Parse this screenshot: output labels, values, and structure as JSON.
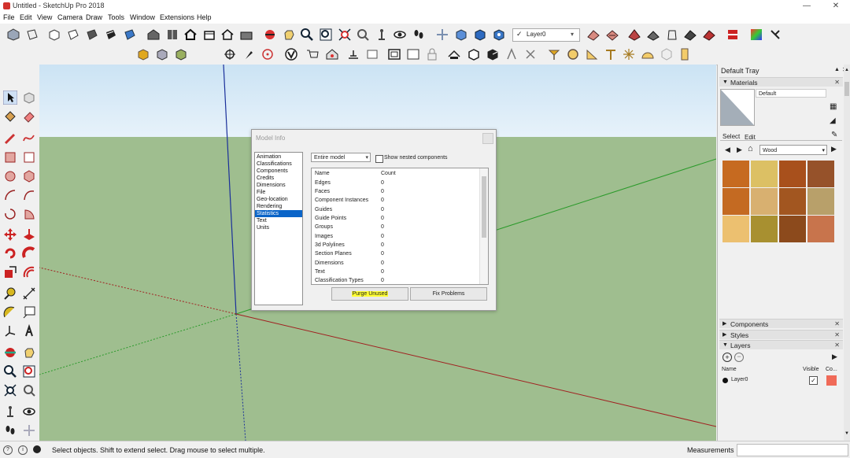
{
  "window": {
    "title": "Untitled - SketchUp Pro 2018",
    "minimize": "—",
    "maximize": "□",
    "close": "✕"
  },
  "menu": [
    "File",
    "Edit",
    "View",
    "Camera",
    "Draw",
    "Tools",
    "Window",
    "Extensions",
    "Help"
  ],
  "toolbar": {
    "layer_value": "Layer0"
  },
  "model_info": {
    "title": "Model Info",
    "categories": [
      "Animation",
      "Classifications",
      "Components",
      "Credits",
      "Dimensions",
      "File",
      "Geo-location",
      "Rendering",
      "Statistics",
      "Text",
      "Units"
    ],
    "selected_category": "Statistics",
    "scope_value": "Entire model",
    "show_nested_label": "Show nested components",
    "columns": {
      "name": "Name",
      "count": "Count"
    },
    "rows": [
      {
        "name": "Edges",
        "count": "0"
      },
      {
        "name": "Faces",
        "count": "0"
      },
      {
        "name": "Component Instances",
        "count": "0"
      },
      {
        "name": "Guides",
        "count": "0"
      },
      {
        "name": "Guide Points",
        "count": "0"
      },
      {
        "name": "Groups",
        "count": "0"
      },
      {
        "name": "Images",
        "count": "0"
      },
      {
        "name": "3d Polylines",
        "count": "0"
      },
      {
        "name": "Section Planes",
        "count": "0"
      },
      {
        "name": "Dimensions",
        "count": "0"
      },
      {
        "name": "Text",
        "count": "0"
      },
      {
        "name": "Classification Types",
        "count": "0"
      }
    ],
    "purge_label": "Purge Unused",
    "fix_label": "Fix Problems"
  },
  "tray": {
    "title": "Default Tray",
    "materials": {
      "header": "Materials",
      "default_name": "Default",
      "tab_select": "Select",
      "tab_edit": "Edit",
      "library": "Wood",
      "swatch_colors": [
        "#c66a20",
        "#dcc064",
        "#a8501c",
        "#96522a",
        "#c46a22",
        "#d8b070",
        "#a25620",
        "#b8a06a",
        "#ecc070",
        "#a89030",
        "#8c4a1c",
        "#c8744c"
      ]
    },
    "components_header": "Components",
    "styles_header": "Styles",
    "layers": {
      "header": "Layers",
      "col_name": "Name",
      "col_visible": "Visible",
      "col_color": "Co...",
      "layer_name": "Layer0",
      "layer_color": "#f06a58"
    }
  },
  "status": {
    "message": "Select objects. Shift to extend select. Drag mouse to select multiple.",
    "measurements_label": "Measurements"
  },
  "colors": {
    "selection": "#0a64c8",
    "ground": "#9fbe8f",
    "highlight": "#ffff33"
  }
}
